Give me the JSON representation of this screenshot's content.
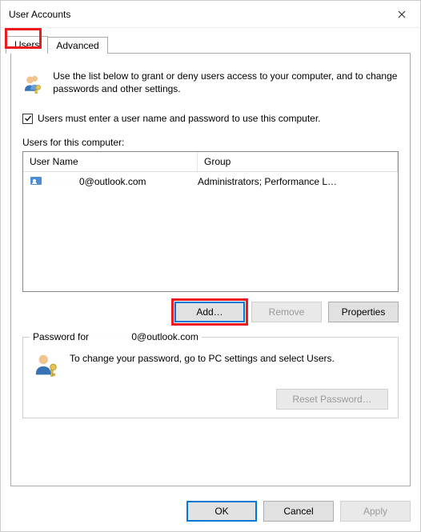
{
  "window": {
    "title": "User Accounts"
  },
  "tabs": {
    "users": "Users",
    "advanced": "Advanced"
  },
  "intro_text": "Use the list below to grant or deny users access to your computer, and to change passwords and other settings.",
  "checkbox": {
    "checked": true,
    "label": "Users must enter a user name and password to use this computer."
  },
  "list": {
    "label": "Users for this computer:",
    "columns": {
      "username": "User Name",
      "group": "Group"
    },
    "rows": [
      {
        "username_obscured": "··········",
        "username_suffix": "0@outlook.com",
        "group": "Administrators; Performance L…"
      }
    ]
  },
  "buttons": {
    "add": "Add…",
    "remove": "Remove",
    "properties": "Properties",
    "reset_password": "Reset Password…",
    "ok": "OK",
    "cancel": "Cancel",
    "apply": "Apply"
  },
  "password_group": {
    "legend_prefix": "Password for",
    "legend_obscured": "··········",
    "legend_suffix": "0@outlook.com",
    "text": "To change your password, go to PC settings and select Users."
  }
}
